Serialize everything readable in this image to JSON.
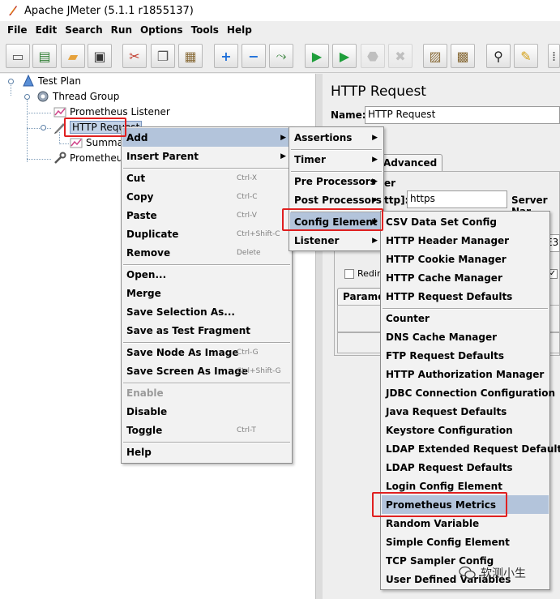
{
  "window": {
    "title": "Apache JMeter (5.1.1 r1855137)"
  },
  "menubar": [
    "File",
    "Edit",
    "Search",
    "Run",
    "Options",
    "Tools",
    "Help"
  ],
  "toolbar": [
    {
      "icon": "new-icon",
      "glyph": "▭"
    },
    {
      "icon": "templates-icon",
      "glyph": "▤"
    },
    {
      "icon": "open-icon",
      "glyph": "▰"
    },
    {
      "icon": "save-icon",
      "glyph": "▣"
    },
    {
      "icon": "cut-icon",
      "glyph": "✂"
    },
    {
      "icon": "copy-icon",
      "glyph": "❐"
    },
    {
      "icon": "paste-icon",
      "glyph": "▦"
    },
    {
      "icon": "expand-icon",
      "glyph": "+"
    },
    {
      "icon": "collapse-icon",
      "glyph": "−"
    },
    {
      "icon": "toggle-icon",
      "glyph": "⤳"
    },
    {
      "icon": "start-icon",
      "glyph": "▶"
    },
    {
      "icon": "start-no-pauses-icon",
      "glyph": "▶"
    },
    {
      "icon": "stop-icon",
      "glyph": "⬣"
    },
    {
      "icon": "shutdown-icon",
      "glyph": "✖"
    },
    {
      "icon": "clear-icon",
      "glyph": "▨"
    },
    {
      "icon": "clear-all-icon",
      "glyph": "▩"
    },
    {
      "icon": "search-binoculars-icon",
      "glyph": "⚲"
    },
    {
      "icon": "reset-search-icon",
      "glyph": "✎"
    },
    {
      "icon": "function-helper-icon",
      "glyph": "⁞"
    }
  ],
  "tree": {
    "test_plan": "Test Plan",
    "thread_group": "Thread Group",
    "prometheus_listener": "Prometheus Listener",
    "http_request": "HTTP Request",
    "summary": "Summa",
    "prometheus_other": "Prometheu"
  },
  "right_panel": {
    "title": "HTTP Request",
    "name_label": "Name:",
    "name_value": "HTTP Request",
    "tab_advanced": "Advanced",
    "section_fragment": "er",
    "protocol_label": "ttp]:",
    "protocol_value": "https",
    "server_label": "Server Nar",
    "redirect_label": "Redire",
    "params_tab": "Parame",
    "field_fragment": "E3"
  },
  "context_menu": {
    "items": [
      {
        "label": "Add",
        "shortcut": "",
        "submenu": true,
        "highlight": true,
        "disabled": false
      },
      {
        "label": "Insert Parent",
        "shortcut": "",
        "submenu": true,
        "highlight": false,
        "disabled": false
      },
      {
        "label": "Cut",
        "shortcut": "Ctrl-X",
        "submenu": false,
        "highlight": false,
        "disabled": false
      },
      {
        "label": "Copy",
        "shortcut": "Ctrl-C",
        "submenu": false,
        "highlight": false,
        "disabled": false
      },
      {
        "label": "Paste",
        "shortcut": "Ctrl-V",
        "submenu": false,
        "highlight": false,
        "disabled": false
      },
      {
        "label": "Duplicate",
        "shortcut": "Ctrl+Shift-C",
        "submenu": false,
        "highlight": false,
        "disabled": false
      },
      {
        "label": "Remove",
        "shortcut": "Delete",
        "submenu": false,
        "highlight": false,
        "disabled": false
      },
      {
        "label": "Open...",
        "shortcut": "",
        "submenu": false,
        "highlight": false,
        "disabled": false
      },
      {
        "label": "Merge",
        "shortcut": "",
        "submenu": false,
        "highlight": false,
        "disabled": false
      },
      {
        "label": "Save Selection As...",
        "shortcut": "",
        "submenu": false,
        "highlight": false,
        "disabled": false
      },
      {
        "label": "Save as Test Fragment",
        "shortcut": "",
        "submenu": false,
        "highlight": false,
        "disabled": false
      },
      {
        "label": "Save Node As Image",
        "shortcut": "Ctrl-G",
        "submenu": false,
        "highlight": false,
        "disabled": false
      },
      {
        "label": "Save Screen As Image",
        "shortcut": "Ctrl+Shift-G",
        "submenu": false,
        "highlight": false,
        "disabled": false
      },
      {
        "label": "Enable",
        "shortcut": "",
        "submenu": false,
        "highlight": false,
        "disabled": true
      },
      {
        "label": "Disable",
        "shortcut": "",
        "submenu": false,
        "highlight": false,
        "disabled": false
      },
      {
        "label": "Toggle",
        "shortcut": "Ctrl-T",
        "submenu": false,
        "highlight": false,
        "disabled": false
      },
      {
        "label": "Help",
        "shortcut": "",
        "submenu": false,
        "highlight": false,
        "disabled": false
      }
    ]
  },
  "add_submenu": {
    "items": [
      {
        "label": "Assertions",
        "highlight": false
      },
      {
        "label": "Timer",
        "highlight": false
      },
      {
        "label": "Pre Processors",
        "highlight": false
      },
      {
        "label": "Post Processors",
        "highlight": false
      },
      {
        "label": "Config Element",
        "highlight": true
      },
      {
        "label": "Listener",
        "highlight": false
      }
    ]
  },
  "config_submenu": {
    "items": [
      {
        "label": "CSV Data Set Config",
        "highlight": false
      },
      {
        "label": "HTTP Header Manager",
        "highlight": false
      },
      {
        "label": "HTTP Cookie Manager",
        "highlight": false
      },
      {
        "label": "HTTP Cache Manager",
        "highlight": false
      },
      {
        "label": "HTTP Request Defaults",
        "highlight": false
      },
      {
        "label": "Counter",
        "highlight": false
      },
      {
        "label": "DNS Cache Manager",
        "highlight": false
      },
      {
        "label": "FTP Request Defaults",
        "highlight": false
      },
      {
        "label": "HTTP Authorization Manager",
        "highlight": false
      },
      {
        "label": "JDBC Connection Configuration",
        "highlight": false
      },
      {
        "label": "Java Request Defaults",
        "highlight": false
      },
      {
        "label": "Keystore Configuration",
        "highlight": false
      },
      {
        "label": "LDAP Extended Request Defaults",
        "highlight": false
      },
      {
        "label": "LDAP Request Defaults",
        "highlight": false
      },
      {
        "label": "Login Config Element",
        "highlight": false
      },
      {
        "label": "Prometheus Metrics",
        "highlight": true
      },
      {
        "label": "Random Variable",
        "highlight": false
      },
      {
        "label": "Simple Config Element",
        "highlight": false
      },
      {
        "label": "TCP Sampler Config",
        "highlight": false
      },
      {
        "label": "User Defined Variables",
        "highlight": false
      }
    ]
  },
  "watermark": {
    "text": "软测小生"
  },
  "colors": {
    "menu_highlight": "#b3c4db",
    "annotation_red": "#e02020",
    "tree_selection": "#c3d3e8"
  }
}
